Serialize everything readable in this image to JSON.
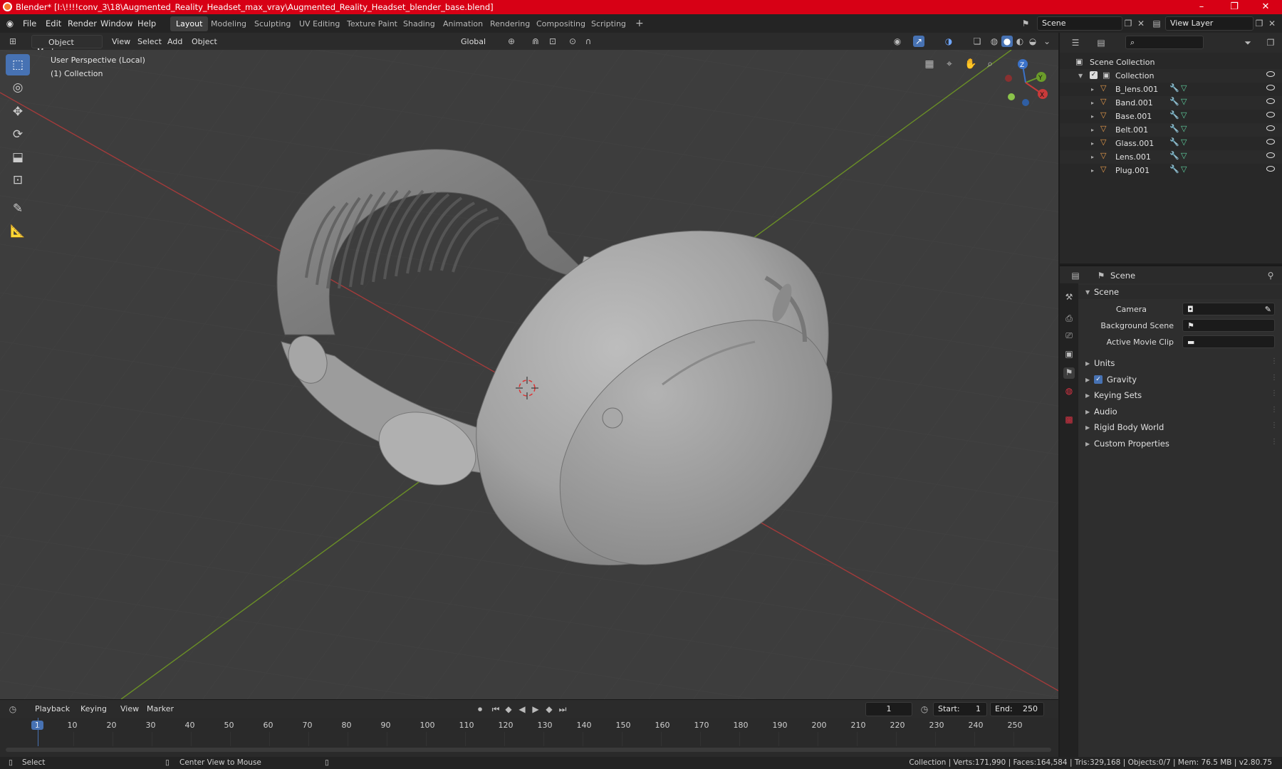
{
  "titlebar": {
    "title": "Blender* [I:\\!!!!conv_3\\18\\Augmented_Reality_Headset_max_vray\\Augmented_Reality_Headset_blender_base.blend]",
    "minimize": "–",
    "maximize": "❐",
    "close": "✕"
  },
  "menu": {
    "file": "File",
    "edit": "Edit",
    "render": "Render",
    "window": "Window",
    "help": "Help"
  },
  "workspaces": [
    "Layout",
    "Modeling",
    "Sculpting",
    "UV Editing",
    "Texture Paint",
    "Shading",
    "Animation",
    "Rendering",
    "Compositing",
    "Scripting"
  ],
  "add_workspace": "+",
  "scene_field": "Scene",
  "view_layer_field": "View Layer",
  "viewport_header": {
    "mode": "Object Mode",
    "view": "View",
    "select": "Select",
    "add": "Add",
    "object": "Object",
    "orientation": "Global"
  },
  "viewport": {
    "perspective": "User Perspective (Local)",
    "collection": "(1) Collection",
    "gizmo": {
      "x": "X",
      "y": "Y",
      "z": "Z"
    }
  },
  "outliner": {
    "root": "Scene Collection",
    "collection": "Collection",
    "objects": [
      "B_lens.001",
      "Band.001",
      "Base.001",
      "Belt.001",
      "Glass.001",
      "Lens.001",
      "Plug.001"
    ]
  },
  "properties": {
    "header": "Scene",
    "section": "Scene",
    "camera_label": "Camera",
    "background_label": "Background Scene",
    "clip_label": "Active Movie Clip",
    "panels": [
      "Units",
      "Gravity",
      "Keying Sets",
      "Audio",
      "Rigid Body World",
      "Custom Properties"
    ],
    "gravity_checked": true
  },
  "timeline_header": {
    "playback": "Playback",
    "keying": "Keying",
    "view": "View",
    "marker": "Marker",
    "current_frame": "1",
    "start_label": "Start:",
    "start": "1",
    "end_label": "End:",
    "end": "250"
  },
  "timeline_ticks": [
    "1",
    "10",
    "20",
    "30",
    "40",
    "50",
    "60",
    "70",
    "80",
    "90",
    "100",
    "110",
    "120",
    "130",
    "140",
    "150",
    "160",
    "170",
    "180",
    "190",
    "200",
    "210",
    "220",
    "230",
    "240",
    "250"
  ],
  "statusbar": {
    "select": "Select",
    "center": "Center View to Mouse",
    "stats": "Collection | Verts:171,990 | Faces:164,584 | Tris:329,168 | Objects:0/7 | Mem: 76.5 MB | v2.80.75"
  },
  "colors": {
    "titlebar": "#d70015",
    "accent": "#4772b3",
    "axis_x": "#c93a3a",
    "axis_y": "#6b9c2a",
    "axis_z": "#3b72c9"
  }
}
